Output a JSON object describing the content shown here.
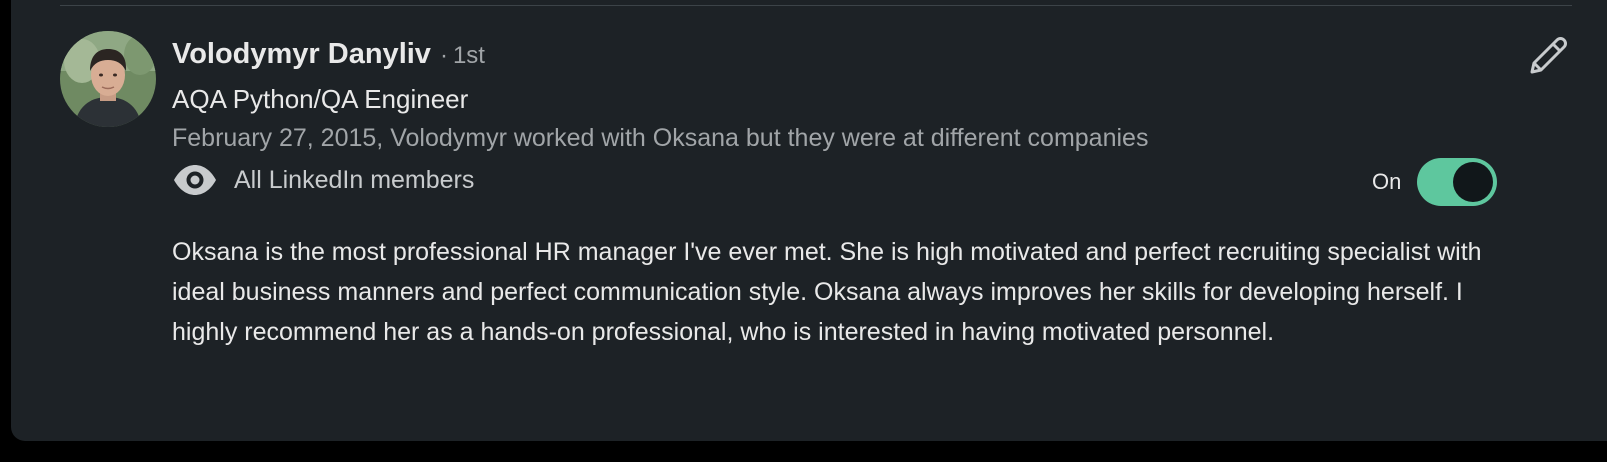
{
  "recommendation": {
    "author_name": "Volodymyr Danyliv",
    "separator": "·",
    "connection_degree": "1st",
    "headline": "AQA Python/QA Engineer",
    "relationship": "February 27, 2015, Volodymyr worked with Oksana but they were at different companies",
    "visibility_label": "All LinkedIn members",
    "toggle_label": "On",
    "toggle_state": "on",
    "text": "Oksana is the most professional HR manager I've ever met. She is high motivated and perfect recruiting specialist with ideal business manners and perfect communication style. Oksana always improves her skills for developing herself. I highly recommend her as a hands-on professional, who is interested in having motivated personnel."
  },
  "icons": {
    "avatar": "profile-photo",
    "visibility": "eye-icon",
    "edit": "pencil-icon"
  },
  "colors": {
    "background": "#1d2226",
    "primary_text": "#e9e9e9",
    "secondary_text": "#a1a5a8",
    "toggle_on": "#5ec79e"
  }
}
